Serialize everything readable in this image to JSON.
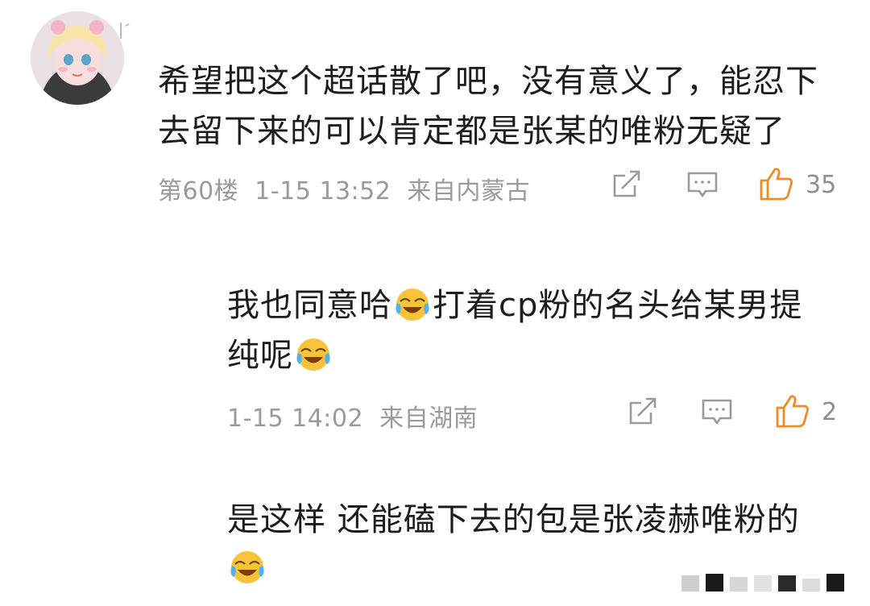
{
  "main_comment": {
    "line1": "希望把这个超话散了吧，没有意义了，能忍下",
    "line2": "去留下来的可以肯定都是张某的唯粉无疑了",
    "floor": "第60楼",
    "time": "1-15 13:52",
    "location": "来自内蒙古",
    "likes": "35"
  },
  "replies": [
    {
      "line1_a": "我也同意哈",
      "line1_b": "打着cp粉的名头给某男提",
      "line2": "纯呢",
      "time": "1-15 14:02",
      "location": "来自湖南",
      "likes": "2"
    },
    {
      "line1": "是这样 还能磕下去的包是张凌赫唯粉的"
    }
  ],
  "icons": {
    "share": "share-icon",
    "comment": "comment-icon",
    "like": "thumbs-up-icon",
    "emoji": "laughing-crying-emoji-icon"
  },
  "colors": {
    "like_accent": "#f08a24",
    "meta_text": "#9a9a9a",
    "body_text": "#1c1c1c"
  }
}
